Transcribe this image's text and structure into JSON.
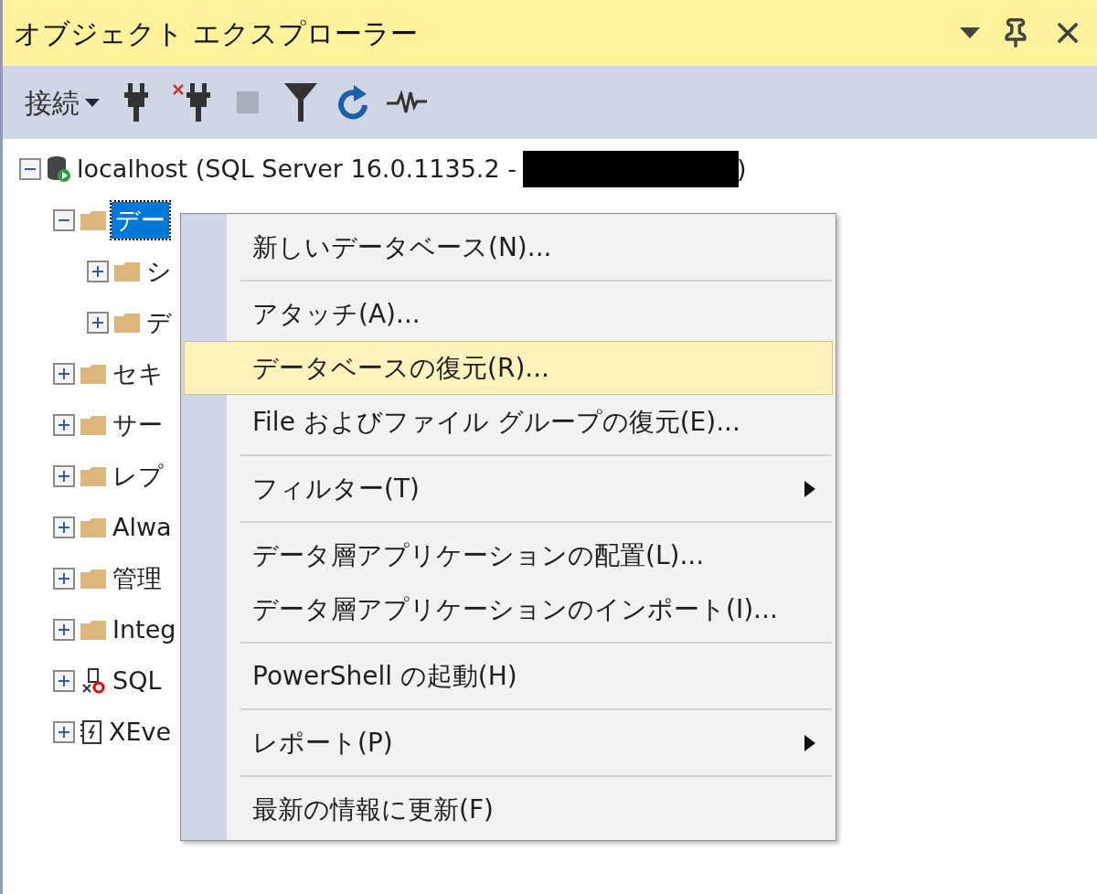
{
  "panel": {
    "title": "オブジェクト エクスプローラー"
  },
  "toolbar": {
    "connect_label": "接続",
    "buttons": [
      {
        "kind": "plug",
        "disabled": false
      },
      {
        "kind": "unplug",
        "disabled": false
      },
      {
        "kind": "stop",
        "disabled": true
      },
      {
        "kind": "filter",
        "disabled": false
      },
      {
        "kind": "refresh",
        "disabled": false
      },
      {
        "kind": "activity",
        "disabled": false
      }
    ]
  },
  "tree": [
    {
      "kind": "server",
      "label": "localhost (SQL Server 16.0.1135.2 -",
      "label_end": ")",
      "redacted": true,
      "expanded": true,
      "selected": false,
      "children": [
        {
          "kind": "folder",
          "label": "デー",
          "expanded": true,
          "selected": true,
          "children": [
            {
              "kind": "folder",
              "label": "シ",
              "expanded": false,
              "selected": false
            },
            {
              "kind": "folder",
              "label": "デ",
              "expanded": false,
              "selected": false
            }
          ]
        },
        {
          "kind": "folder",
          "label": "セキ",
          "expanded": false,
          "selected": false
        },
        {
          "kind": "folder",
          "label": "サー",
          "expanded": false,
          "selected": false
        },
        {
          "kind": "folder",
          "label": "レプ",
          "expanded": false,
          "selected": false
        },
        {
          "kind": "folder",
          "label": "Alwa",
          "expanded": false,
          "selected": false
        },
        {
          "kind": "folder",
          "label": "管理",
          "expanded": false,
          "selected": false
        },
        {
          "kind": "folder",
          "label": "Integ",
          "expanded": false,
          "selected": false
        },
        {
          "kind": "agent",
          "label": "SQL",
          "expanded": false,
          "selected": false
        },
        {
          "kind": "xevent",
          "label": "XEve",
          "expanded": false,
          "selected": false
        }
      ]
    }
  ],
  "context_menu": {
    "groups": [
      [
        {
          "label": "新しいデータベース(N)...",
          "selected": false,
          "submenu": false
        }
      ],
      [
        {
          "label": "アタッチ(A)...",
          "selected": false,
          "submenu": false
        },
        {
          "label": "データベースの復元(R)...",
          "selected": true,
          "submenu": false
        },
        {
          "label": "File およびファイル グループの復元(E)...",
          "selected": false,
          "submenu": false
        }
      ],
      [
        {
          "label": "フィルター(T)",
          "selected": false,
          "submenu": true
        }
      ],
      [
        {
          "label": "データ層アプリケーションの配置(L)...",
          "selected": false,
          "submenu": false
        },
        {
          "label": "データ層アプリケーションのインポート(I)...",
          "selected": false,
          "submenu": false
        }
      ],
      [
        {
          "label": "PowerShell の起動(H)",
          "selected": false,
          "submenu": false
        }
      ],
      [
        {
          "label": "レポート(P)",
          "selected": false,
          "submenu": true
        }
      ],
      [
        {
          "label": "最新の情報に更新(F)",
          "selected": false,
          "submenu": false
        }
      ]
    ]
  }
}
